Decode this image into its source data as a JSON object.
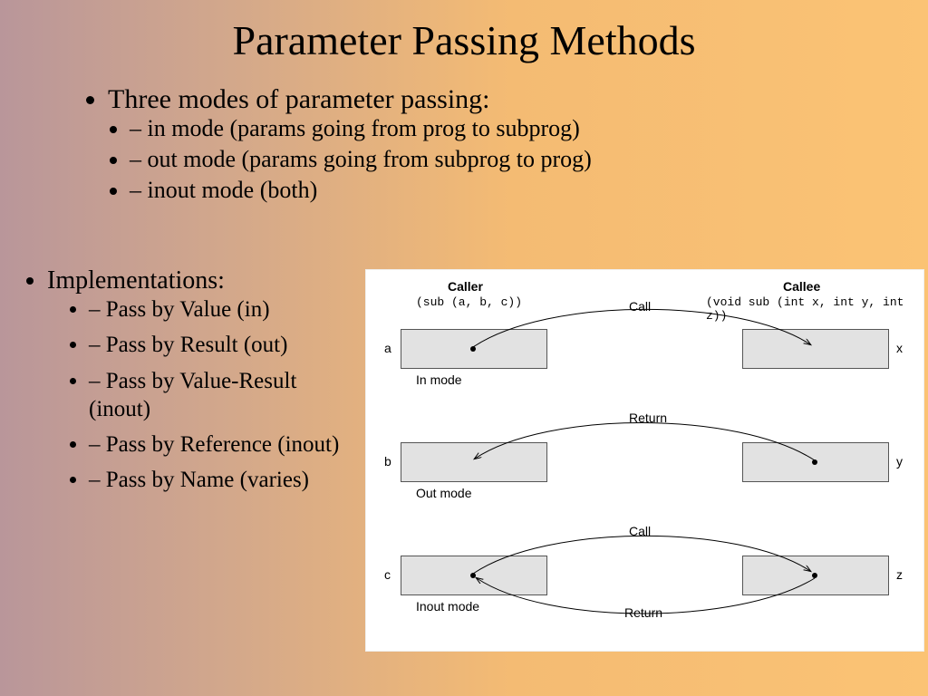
{
  "title": "Parameter Passing Methods",
  "modes": {
    "heading": "Three modes of parameter passing:",
    "items": [
      "in mode (params going from prog to subprog)",
      "out mode (params going from subprog to prog)",
      "inout mode (both)"
    ]
  },
  "implementations": {
    "heading": "Implementations:",
    "items": [
      "Pass by Value (in)",
      "Pass by Result (out)",
      "Pass by Value-Result (inout)",
      "Pass by Reference (inout)",
      "Pass by Name (varies)"
    ]
  },
  "diagram": {
    "caller_title": "Caller",
    "caller_code": "(sub (a, b, c))",
    "callee_title": "Callee",
    "callee_code": "(void sub (int x, int y, int z))",
    "rows": [
      {
        "left": "a",
        "right": "x",
        "mode": "In mode",
        "top_label": "Call"
      },
      {
        "left": "b",
        "right": "y",
        "mode": "Out mode",
        "top_label": "Return"
      },
      {
        "left": "c",
        "right": "z",
        "mode": "Inout mode",
        "top_label": "Call",
        "bottom_label": "Return"
      }
    ]
  }
}
